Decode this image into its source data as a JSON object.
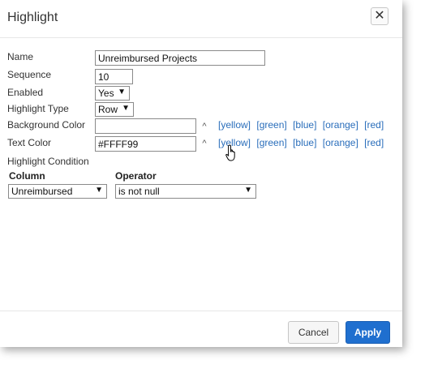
{
  "dialog": {
    "title": "Highlight"
  },
  "form": {
    "name_label": "Name",
    "name_value": "Unreimbursed Projects",
    "sequence_label": "Sequence",
    "sequence_value": "10",
    "enabled_label": "Enabled",
    "enabled_value": "Yes",
    "highlight_type_label": "Highlight Type",
    "highlight_type_value": "Row",
    "background_color_label": "Background Color",
    "background_color_value": "",
    "text_color_label": "Text Color",
    "text_color_value": "#FFFF99",
    "picker_glyph": "^",
    "color_options": [
      "[yellow]",
      "[green]",
      "[blue]",
      "[orange]",
      "[red]"
    ]
  },
  "condition": {
    "section_label": "Highlight Condition",
    "column_header": "Column",
    "operator_header": "Operator",
    "column_value": "Unreimbursed",
    "operator_value": "is not null"
  },
  "footer": {
    "cancel_label": "Cancel",
    "apply_label": "Apply"
  },
  "colors": {
    "link": "#2a6ebb",
    "apply_bg": "#1f6fcf"
  }
}
